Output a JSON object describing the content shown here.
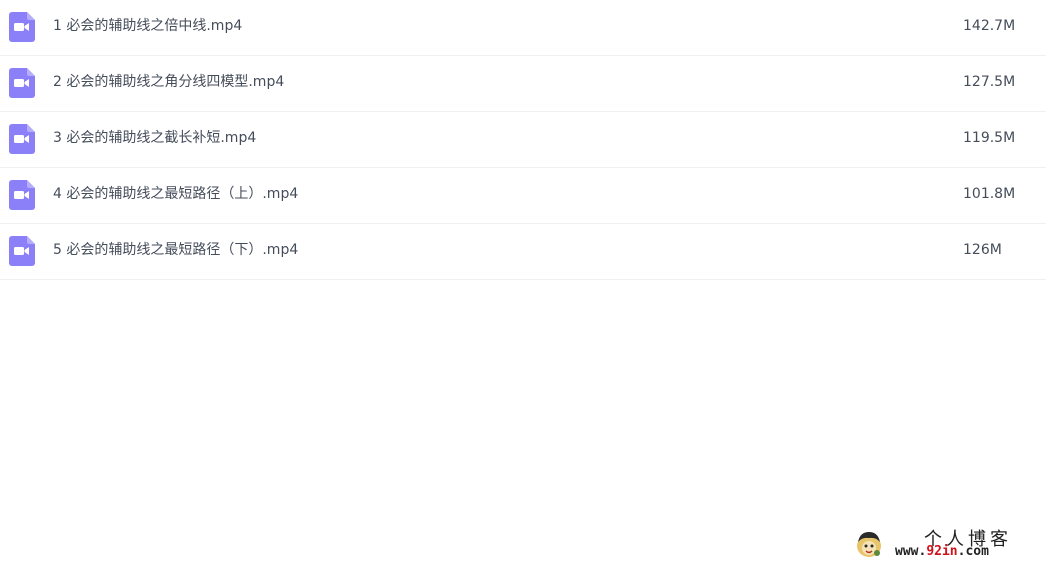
{
  "files": [
    {
      "name": "1 必会的辅助线之倍中线.mp4",
      "size": "142.7M",
      "icon": "video-file-icon"
    },
    {
      "name": "2 必会的辅助线之角分线四模型.mp4",
      "size": "127.5M",
      "icon": "video-file-icon"
    },
    {
      "name": "3 必会的辅助线之截长补短.mp4",
      "size": "119.5M",
      "icon": "video-file-icon"
    },
    {
      "name": "4 必会的辅助线之最短路径（上）.mp4",
      "size": "101.8M",
      "icon": "video-file-icon"
    },
    {
      "name": "5 必会的辅助线之最短路径（下）.mp4",
      "size": "126M",
      "icon": "video-file-icon"
    }
  ],
  "watermark": {
    "title": "个人博客",
    "url_prefix": "www.",
    "url_highlight": "92in",
    "url_suffix": ".com"
  },
  "colors": {
    "icon": "#8c80f8",
    "text": "#454d5a",
    "divider": "#f0f0f2",
    "watermark_highlight": "#d0121b"
  }
}
